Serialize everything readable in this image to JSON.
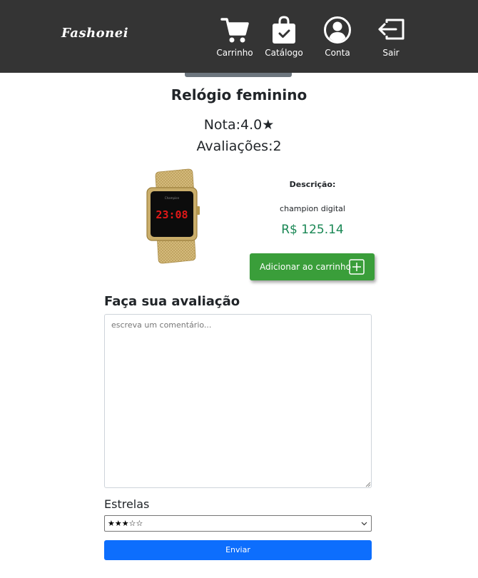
{
  "nav": {
    "brand": "Fashonei",
    "items": [
      {
        "label": "Carrinho",
        "icon": "cart-icon"
      },
      {
        "label": "Catálogo",
        "icon": "shopping-bag-check-icon"
      },
      {
        "label": "Conta",
        "icon": "user-circle-icon"
      },
      {
        "label": "Sair",
        "icon": "logout-arrow-icon"
      }
    ]
  },
  "product": {
    "title": "Relógio feminino",
    "nota": "Nota:4.0★",
    "avaliacoes": "Avaliações:2",
    "watch_time": "23:08",
    "description_label": "Descrição:",
    "description": "champion digital",
    "price": "R$ 125.14",
    "add_to_cart_label": "Adicionar ao carrinho"
  },
  "review": {
    "heading": "Faça sua avaliação",
    "comment_placeholder": "escreva um comentário...",
    "comment_value": "",
    "stars_label": "Estrelas",
    "stars_selected": "★★★☆☆",
    "submit_label": "Enviar"
  },
  "colors": {
    "navbar": "#343434",
    "price": "#198754",
    "add_cart": "#3a9e3a",
    "submit": "#0d6efd"
  }
}
